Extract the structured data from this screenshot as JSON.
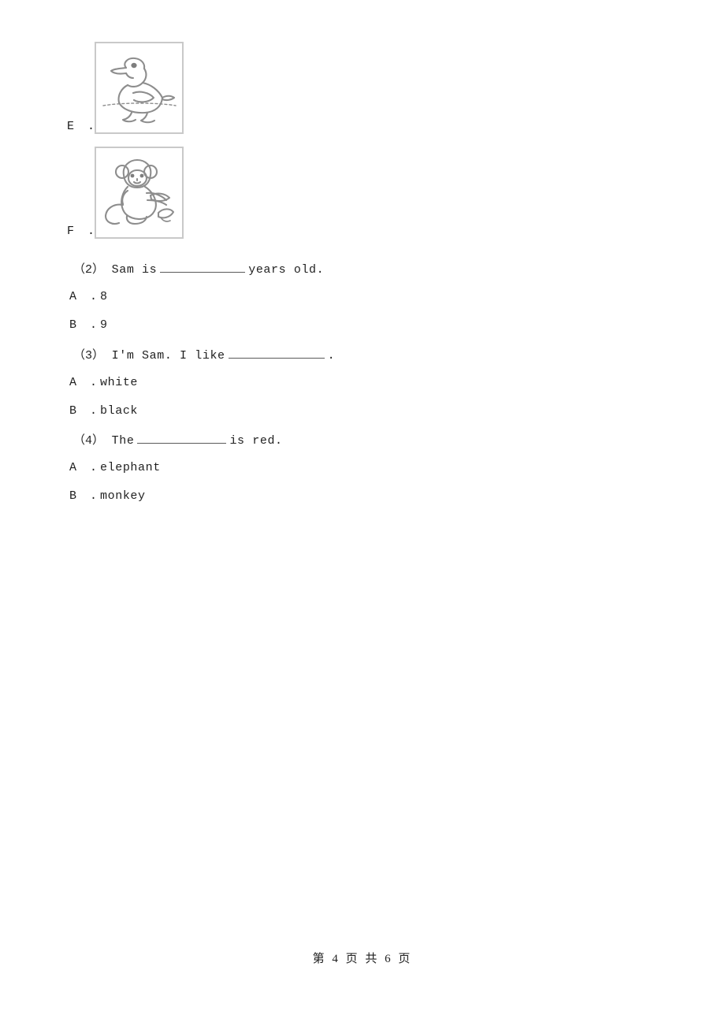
{
  "document": {
    "picture_options": [
      {
        "label": "E .",
        "icon": "duck-line-drawing",
        "alt": "duck"
      },
      {
        "label": "F .",
        "icon": "monkey-line-drawing",
        "alt": "monkey holding a banana"
      }
    ],
    "questions": [
      {
        "number": "（2）",
        "stem_before": "Sam is",
        "stem_after": "years old.",
        "options": [
          {
            "label": "A .",
            "text": "8"
          },
          {
            "label": "B .",
            "text": "9"
          }
        ]
      },
      {
        "number": "（3）",
        "stem_before": "I'm Sam. I like",
        "stem_after": ".",
        "options": [
          {
            "label": "A .",
            "text": "white"
          },
          {
            "label": "B .",
            "text": "black"
          }
        ]
      },
      {
        "number": "（4）",
        "stem_before": "The",
        "stem_after": "is red.",
        "options": [
          {
            "label": "A .",
            "text": "elephant"
          },
          {
            "label": "B .",
            "text": "monkey"
          }
        ]
      }
    ],
    "footer": {
      "text": "第 4 页 共 6 页",
      "current_page": "4",
      "total_pages": "6"
    }
  }
}
